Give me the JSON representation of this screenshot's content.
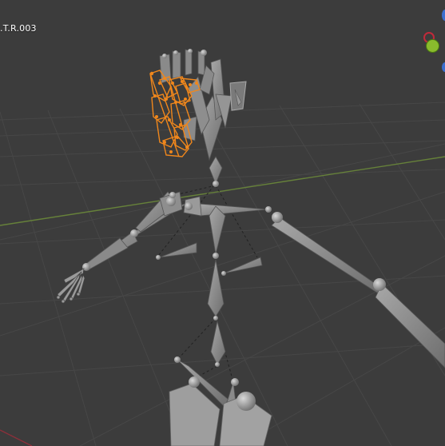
{
  "viewport": {
    "object_label": ".T.R.003"
  },
  "colors": {
    "background": "#3c3c3c",
    "grid": "#4a4a4a",
    "axis_x": "#6f8a3e",
    "axis_y": "#8b2f3a",
    "bone": "#8a8a8a",
    "bone_selected": "#f0871c"
  },
  "gizmo": {
    "icons": [
      "axis-y-icon",
      "axis-x-icon",
      "axis-z-icon"
    ]
  }
}
